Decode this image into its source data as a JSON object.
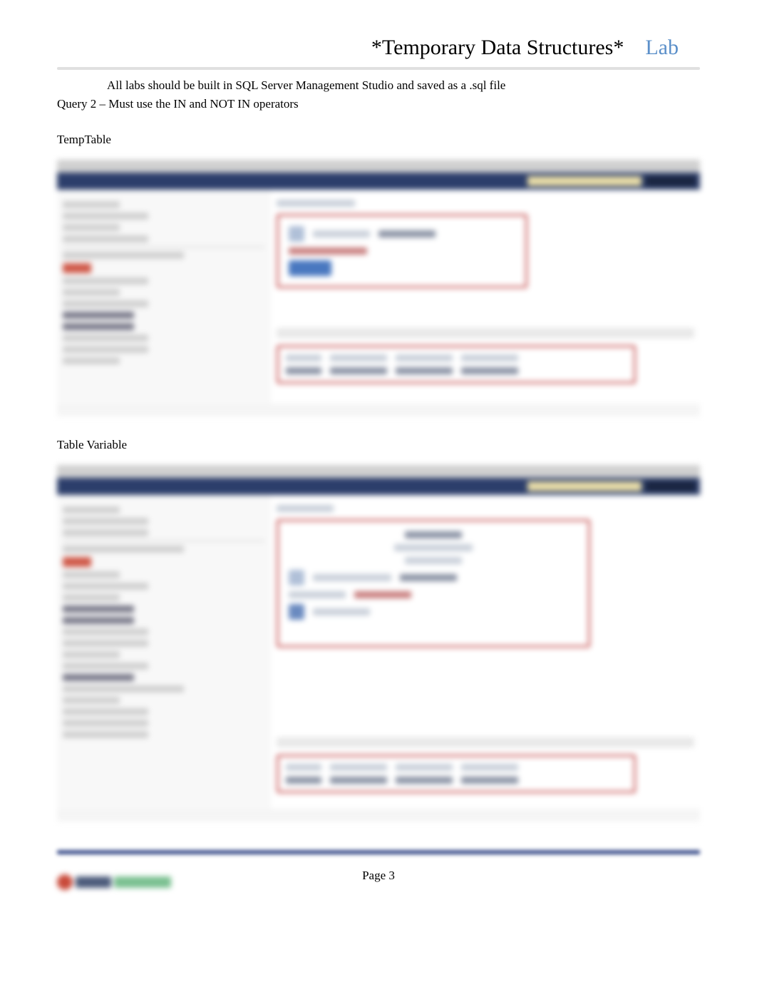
{
  "header": {
    "title": "*Temporary Data Structures*",
    "lab": "Lab"
  },
  "note": {
    "bullet": "",
    "text": "All labs should be built in SQL Server Management Studio and saved as a .sql file"
  },
  "query_line": "Query 2 – Must use the IN and NOT IN operators",
  "section1": "TempTable",
  "section2": "Table Variable",
  "page_label": "Page 3"
}
